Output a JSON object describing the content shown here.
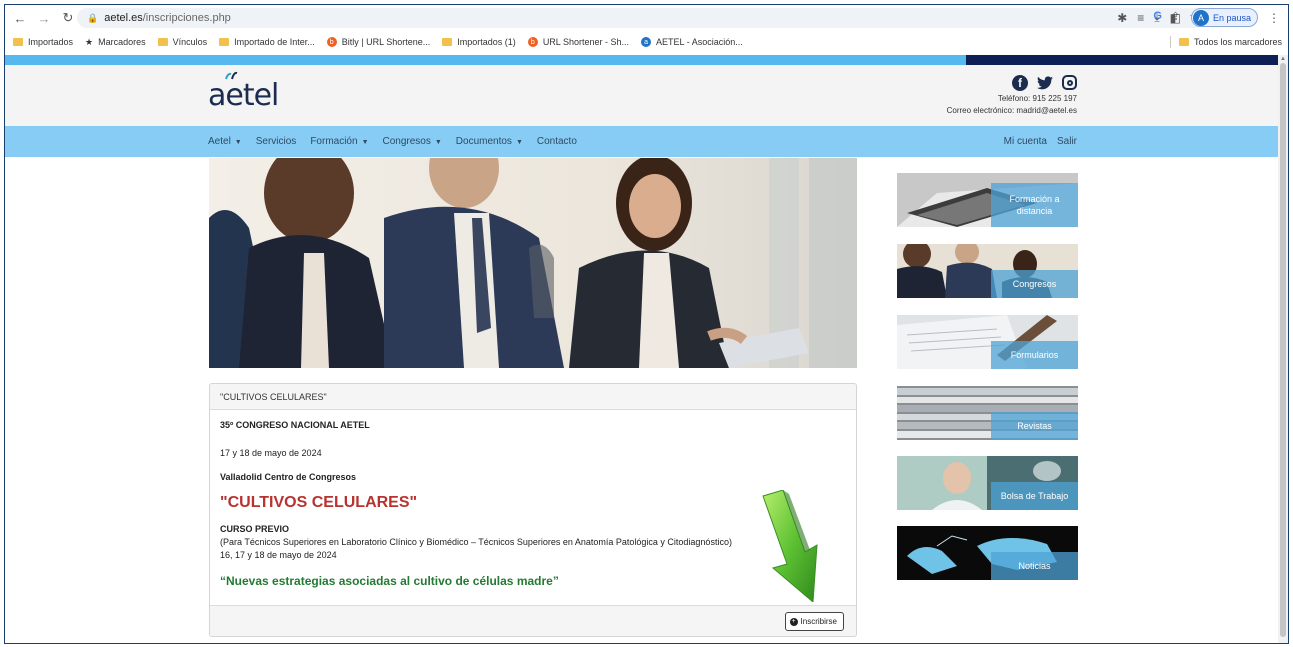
{
  "browser": {
    "url_domain": "aetel.es",
    "url_path": "/inscripciones.php",
    "profile_label": "En pausa"
  },
  "bookmarks": {
    "items": [
      {
        "label": "Importados",
        "icon": "folder"
      },
      {
        "label": "Marcadores",
        "icon": "star"
      },
      {
        "label": "Vínculos",
        "icon": "folder"
      },
      {
        "label": "Importado de Inter...",
        "icon": "folder"
      },
      {
        "label": "Bitly | URL Shortene...",
        "icon": "bitly"
      },
      {
        "label": "Importados (1)",
        "icon": "folder"
      },
      {
        "label": "URL Shortener - Sh...",
        "icon": "bitly"
      },
      {
        "label": "AETEL - Asociación...",
        "icon": "aetel"
      }
    ],
    "all_bookmarks": "Todos los marcadores"
  },
  "header": {
    "logo_text": "aetel",
    "phone": "Teléfono: 915 225 197",
    "email": "Correo electrónico: madrid@aetel.es"
  },
  "menu": {
    "left": [
      "Aetel",
      "Servicios",
      "Formación",
      "Congresos",
      "Documentos",
      "Contacto"
    ],
    "right": [
      "Mi cuenta",
      "Salir"
    ]
  },
  "card": {
    "header": "\"CULTIVOS CELULARES\"",
    "congress_title": "35º CONGRESO NACIONAL AETEL",
    "congress_dates": "17 y 18 de mayo de 2024",
    "venue": "Valladolid Centro de Congresos",
    "main_title": "\"CULTIVOS CELULARES\"",
    "course_label": "CURSO PREVIO",
    "course_audience": "(Para Técnicos Superiores en Laboratorio Clínico y Biomédico – Técnicos Superiores en Anatomía Patológica y Citodiagnóstico)",
    "course_dates": "16, 17 y 18 de mayo de 2024",
    "course_title": "“Nuevas estrategias asociadas al cultivo de células madre”",
    "button": "Inscribirse"
  },
  "sidebar": {
    "items": [
      {
        "label": "Formación a distancia"
      },
      {
        "label": "Congresos"
      },
      {
        "label": "Formularios"
      },
      {
        "label": "Revistas"
      },
      {
        "label": "Bolsa de Trabajo"
      },
      {
        "label": "Noticias"
      }
    ]
  },
  "colors": {
    "menu_bg": "#86ccf4",
    "title_red": "#b8322f",
    "title_green": "#247a34",
    "logo_navy": "#1b2c4f",
    "arrow_green": "#5fc234"
  }
}
